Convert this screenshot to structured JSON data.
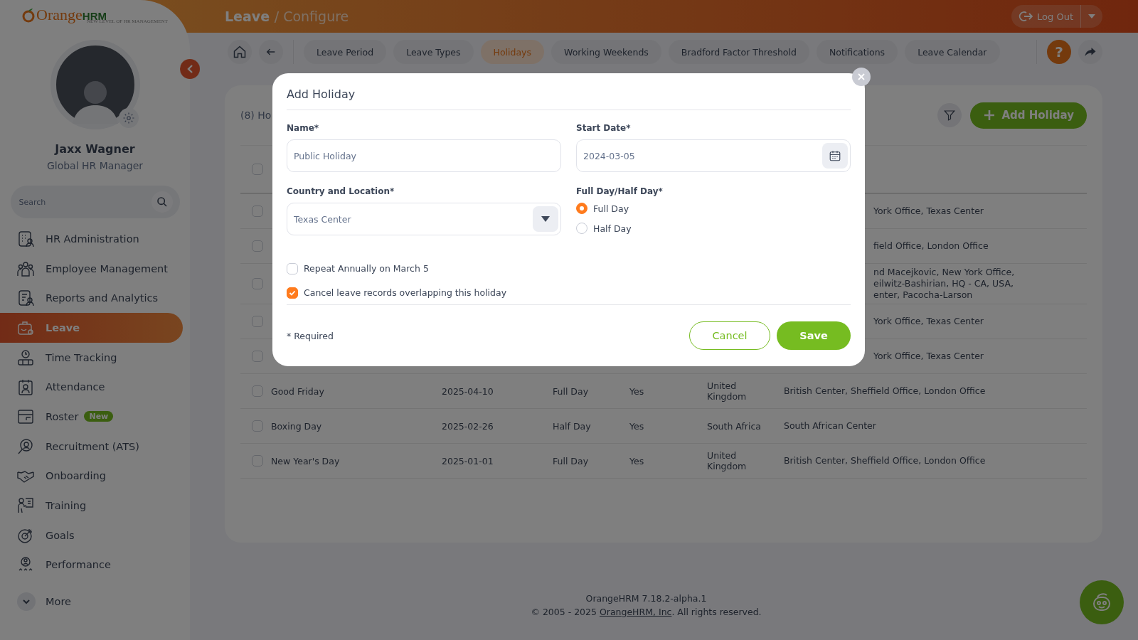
{
  "sidebar": {
    "brand": [
      "Orange",
      "HRM"
    ],
    "tagline": "NEW LEVEL OF HR MANAGEMENT",
    "user": {
      "name": "Jaxx Wagner",
      "role": "Global HR Manager"
    },
    "search": {
      "placeholder": "Search"
    },
    "items": [
      {
        "label": "HR Administration",
        "selected": false
      },
      {
        "label": "Employee Management",
        "selected": false
      },
      {
        "label": "Reports and Analytics",
        "selected": false
      },
      {
        "label": "Leave",
        "selected": true
      },
      {
        "label": "Time Tracking",
        "selected": false
      },
      {
        "label": "Attendance",
        "selected": false
      },
      {
        "label": "Roster",
        "selected": false,
        "badge": "New"
      },
      {
        "label": "Recruitment (ATS)",
        "selected": false
      },
      {
        "label": "Onboarding",
        "selected": false
      },
      {
        "label": "Training",
        "selected": false
      },
      {
        "label": "Goals",
        "selected": false
      },
      {
        "label": "Performance",
        "selected": false
      }
    ],
    "more": "More"
  },
  "top_bar": {
    "module": "Leave",
    "separator": "/",
    "page": "Configure",
    "logout": "Log Out"
  },
  "tabs": [
    {
      "label": "Leave Period",
      "selected": false
    },
    {
      "label": "Leave Types",
      "selected": false
    },
    {
      "label": "Holidays",
      "selected": true
    },
    {
      "label": "Working Weekends",
      "selected": false
    },
    {
      "label": "Bradford Factor Threshold",
      "selected": false
    },
    {
      "label": "Notifications",
      "selected": false
    },
    {
      "label": "Leave Calendar",
      "selected": false
    }
  ],
  "help": "?",
  "card": {
    "title": "(8) Ho",
    "add_button": "Add Holiday",
    "header_checked": false,
    "rows": [
      {
        "kind": "covered",
        "checked": false,
        "location": [
          "York Office, Texas Center"
        ]
      },
      {
        "kind": "covered",
        "checked": false,
        "location": [
          "field Office, London Office"
        ]
      },
      {
        "kind": "covered",
        "checked": false,
        "location": [
          "nd Macejkovic, New York Office,",
          "eilwitz-Bashirian, HQ - CA, USA,",
          "enter, Pacocha-Larson"
        ]
      },
      {
        "kind": "covered",
        "checked": false,
        "location": [
          "York Office, Texas Center"
        ]
      },
      {
        "kind": "covered",
        "checked": false,
        "location": [
          "York Office, Texas Center"
        ]
      },
      {
        "kind": "full",
        "checked": false,
        "name": "Good Friday",
        "date": "2025-04-10",
        "length": "Full Day",
        "recurring": "Yes",
        "country": "United Kingdom",
        "location": [
          "British Center, Sheffield Office, London Office"
        ]
      },
      {
        "kind": "full",
        "checked": false,
        "name": "Boxing Day",
        "date": "2025-02-26",
        "length": "Half Day",
        "recurring": "Yes",
        "country": "South Africa",
        "location": [
          "South African Center"
        ]
      },
      {
        "kind": "full",
        "checked": false,
        "name": "New Year's Day",
        "date": "2025-01-01",
        "length": "Full Day",
        "recurring": "Yes",
        "country": "United Kingdom",
        "location": [
          "British Center, Sheffield Office, London Office"
        ]
      }
    ]
  },
  "footer": {
    "version": "OrangeHRM 7.18.2-alpha.1",
    "copyright_prefix": "© 2005 - 2025 ",
    "link": "OrangeHRM, Inc",
    "copyright_suffix": ". All rights reserved."
  },
  "modal": {
    "title": "Add Holiday",
    "name": {
      "label": "Name*",
      "value": "Public Holiday"
    },
    "start_date": {
      "label": "Start Date*",
      "value": "2024-03-05"
    },
    "country": {
      "label": "Country and Location*",
      "value": "Texas Center"
    },
    "duration": {
      "label": "Full Day/Half Day*",
      "options": [
        {
          "label": "Full Day",
          "selected": true
        },
        {
          "label": "Half Day",
          "selected": false
        }
      ]
    },
    "checkboxes": [
      {
        "label": "Repeat Annually on March 5",
        "checked": false
      },
      {
        "label": "Cancel leave records overlapping this holiday",
        "checked": true
      }
    ],
    "required_note": "* Required",
    "cancel": "Cancel",
    "save": "Save"
  }
}
